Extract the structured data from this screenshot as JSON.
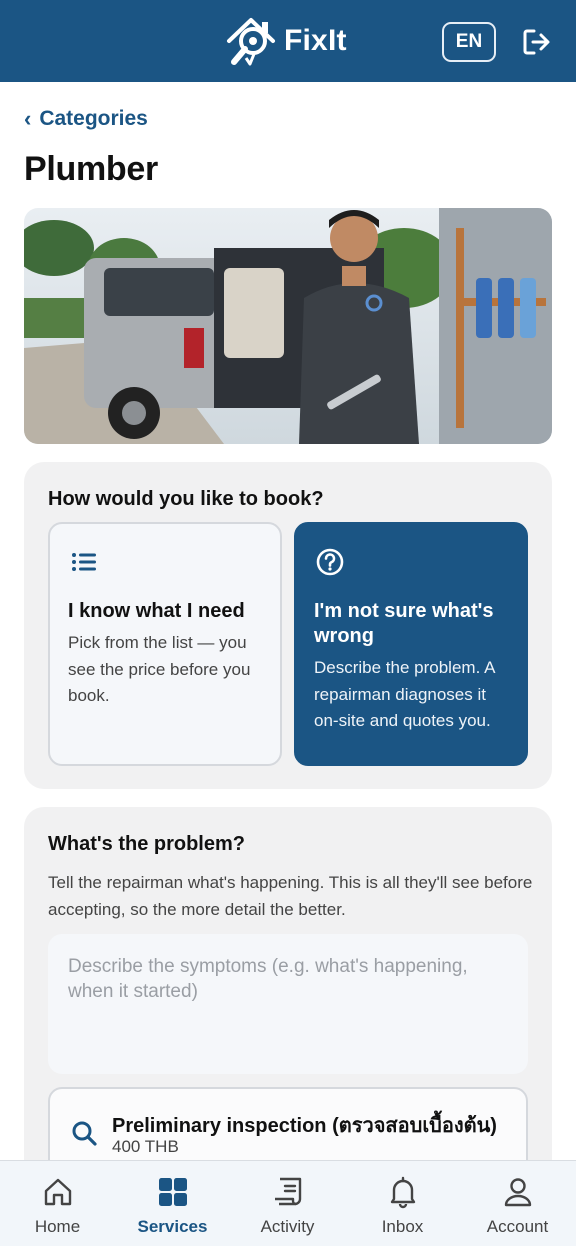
{
  "header": {
    "brand_name": "FixIt",
    "lang_label": "EN"
  },
  "breadcrumb": {
    "back_label": "Categories"
  },
  "page": {
    "title": "Plumber"
  },
  "booking": {
    "question": "How would you like to book?",
    "options": [
      {
        "title": "I know what I need",
        "description": "Pick from the list — you see the price before you book.",
        "icon": "list-icon",
        "selected": false
      },
      {
        "title": "I'm not sure what's wrong",
        "description": "Describe the problem. A repairman diagnoses it on-site and quotes you.",
        "icon": "question-circle-icon",
        "selected": true
      }
    ]
  },
  "problem": {
    "title": "What's the problem?",
    "helper": "Tell the repairman what's happening. This is all they'll see before accepting, so the more detail the better.",
    "placeholder": "Describe the symptoms (e.g. what's happening, when it started)",
    "value": ""
  },
  "inspection": {
    "name": "Preliminary inspection (ตรวจสอบเบื้องต้น)",
    "price": "400 THB"
  },
  "nav": {
    "items": [
      {
        "label": "Home",
        "icon": "home-icon",
        "active": false
      },
      {
        "label": "Services",
        "icon": "grid-icon",
        "active": true
      },
      {
        "label": "Activity",
        "icon": "receipt-icon",
        "active": false
      },
      {
        "label": "Inbox",
        "icon": "bell-icon",
        "active": false
      },
      {
        "label": "Account",
        "icon": "person-icon",
        "active": false
      }
    ]
  },
  "colors": {
    "primary": "#1b5584",
    "card_bg": "#f1f1f2",
    "nav_bg": "#f2f6fa"
  }
}
